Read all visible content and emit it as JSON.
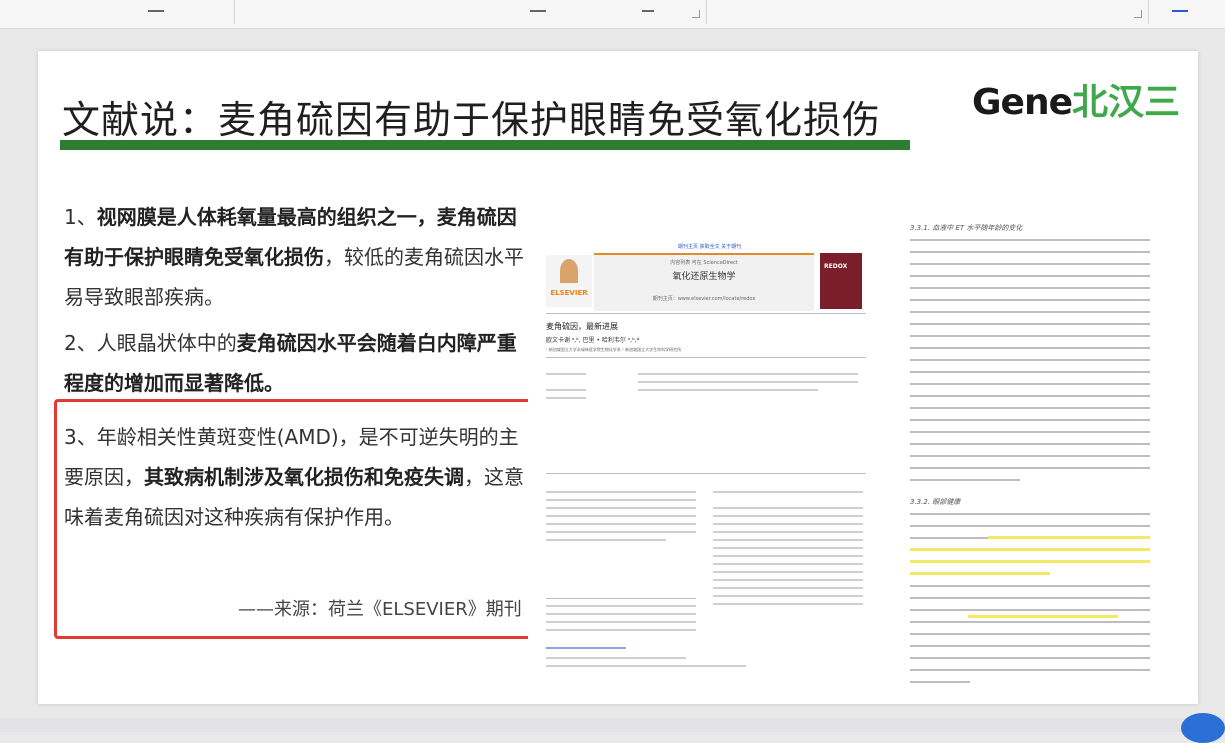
{
  "slide": {
    "title": "文献说：麦角硫因有助于保护眼睛免受氧化损伤",
    "logo": {
      "latin": "Gene",
      "cn": "北汉三"
    },
    "points": [
      {
        "num": "1、",
        "bold1": "视网膜是人体耗氧量最高的组织之一，",
        "bold2": "麦角硫因有助于保护眼睛免受氧化损伤",
        "rest": "，较低的麦角硫因水平易导致眼部疾病。"
      },
      {
        "num": "2、",
        "pre": "人眼晶状体中的",
        "bold": "麦角硫因水平会随着白内障严重程度的增加而显著降低。"
      },
      {
        "num": "3、",
        "pre": "年龄相关性黄斑变性(AMD)，是不可逆失明的主要原因，",
        "bold": "其致病机制涉及氧化损伤和免疫失调",
        "rest": "，这意味着麦角硫因对这种疾病有保护作用。"
      }
    ],
    "source": "——来源：荷兰《ELSEVIER》期刊"
  },
  "paper": {
    "journal_link": "期刊主页 获取全文 关于期刊",
    "contents_line": "内容列表 可在 ScienceDirect",
    "journal_name": "氧化还原生物学",
    "journal_home": "期刊主页：www.elsevier.com/locate/redox",
    "publisher": "ELSEVIER",
    "cover_text": "REDOX",
    "article_title": "麦角硫因，最新进展",
    "authors": "欧文卡谢 ᵃ,ᵇ, 巴里 • 哈利韦尔 ᵃ,ᵇ,*",
    "affiliation": "ᵃ 新加坡国立大学永禄林医学院生物化学系 ᵇ 新加坡国立大学生命科学研究所"
  },
  "right_column": {
    "section1": "3.3.1. 血液中 ET 水平随年龄的变化",
    "section2": "3.3.2. 眼部健康"
  }
}
